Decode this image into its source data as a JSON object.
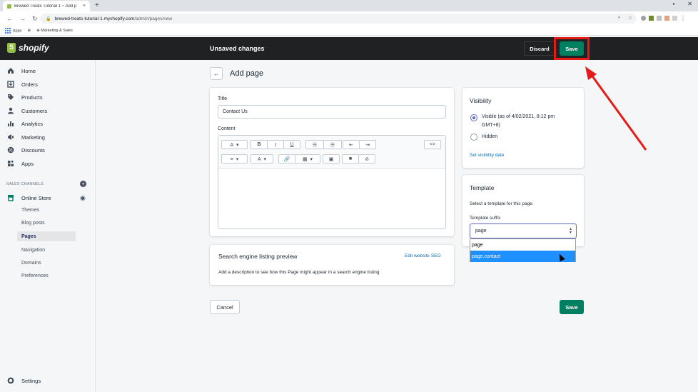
{
  "browser": {
    "tab_title": "Brewed Treats Tutorial 1 ~ Add p",
    "tab_close": "×",
    "new_tab": "+",
    "url_host": "brewed-treats-tutorial-1.myshopify.com",
    "url_path": "/admin/pages/new",
    "bookmarks": [
      "Apps",
      "Marketing & Sales"
    ]
  },
  "topbar": {
    "brand": "shopify",
    "status": "Unsaved changes",
    "discard_label": "Discard",
    "save_label": "Save",
    "highlight_color": "#e41b17"
  },
  "sidebar": {
    "items": [
      {
        "label": "Home",
        "icon": "home-icon"
      },
      {
        "label": "Orders",
        "icon": "orders-icon"
      },
      {
        "label": "Products",
        "icon": "tag-icon"
      },
      {
        "label": "Customers",
        "icon": "person-icon"
      },
      {
        "label": "Analytics",
        "icon": "bar-chart-icon"
      },
      {
        "label": "Marketing",
        "icon": "megaphone-icon"
      },
      {
        "label": "Discounts",
        "icon": "discount-icon"
      },
      {
        "label": "Apps",
        "icon": "apps-icon"
      }
    ],
    "sales_channels_heading": "SALES CHANNELS",
    "online_store": "Online Store",
    "sub_items": [
      "Themes",
      "Blog posts",
      "Pages",
      "Navigation",
      "Domains",
      "Preferences"
    ],
    "settings": "Settings"
  },
  "main": {
    "back_icon": "←",
    "page_title": "Add page",
    "title_label": "Title",
    "title_value": "Contact Us",
    "content_label": "Content",
    "seo": {
      "heading": "Search engine listing preview",
      "edit_link": "Edit website SEO",
      "description": "Add a description to see how this Page might appear in a search engine listing"
    },
    "cancel_label": "Cancel",
    "save_label": "Save"
  },
  "visibility": {
    "heading": "Visibility",
    "visible_label_line1": "Visible (as of 4/02/2021, 8:12 pm",
    "visible_label_line2": "GMT+8)",
    "hidden_label": "Hidden",
    "set_date_link": "Set visibility date",
    "selected": "visible"
  },
  "template": {
    "heading": "Template",
    "description": "Select a template for this page.",
    "suffix_label": "Template suffix",
    "current_value": "page",
    "options": [
      "page",
      "page.contact"
    ],
    "highlighted_option": "page.contact"
  },
  "colors": {
    "topbar_bg": "#202123",
    "primary_button": "#008060",
    "sidebar_bg": "#f4f6f8",
    "link": "#006fbb",
    "annotation": "#e41b17",
    "dropdown_highlight": "#1e90ff"
  }
}
